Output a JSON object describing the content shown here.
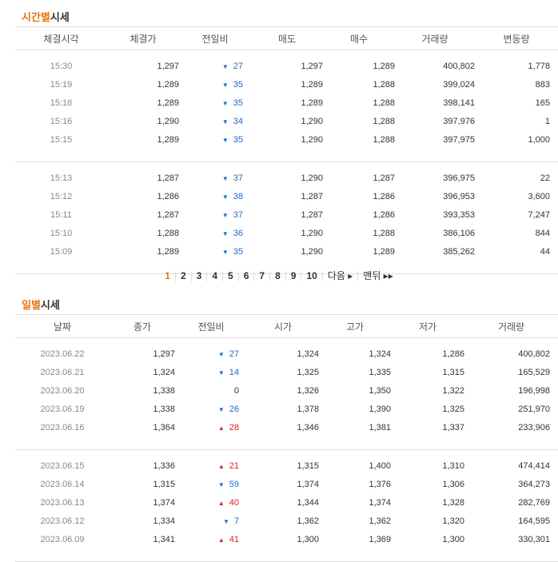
{
  "time_section": {
    "title_accent": "시간별",
    "title_rest": "시세",
    "headers": [
      "체결시각",
      "체결가",
      "전일비",
      "매도",
      "매수",
      "거래량",
      "변동량"
    ],
    "groups": [
      [
        {
          "time": "15:30",
          "price": "1,297",
          "dir": "down",
          "arrow": "▼",
          "change": "27",
          "ask": "1,297",
          "bid": "1,289",
          "volume": "400,802",
          "delta": "1,778"
        },
        {
          "time": "15:19",
          "price": "1,289",
          "dir": "down",
          "arrow": "▼",
          "change": "35",
          "ask": "1,289",
          "bid": "1,288",
          "volume": "399,024",
          "delta": "883"
        },
        {
          "time": "15:18",
          "price": "1,289",
          "dir": "down",
          "arrow": "▼",
          "change": "35",
          "ask": "1,289",
          "bid": "1,288",
          "volume": "398,141",
          "delta": "165"
        },
        {
          "time": "15:16",
          "price": "1,290",
          "dir": "down",
          "arrow": "▼",
          "change": "34",
          "ask": "1,290",
          "bid": "1,288",
          "volume": "397,976",
          "delta": "1"
        },
        {
          "time": "15:15",
          "price": "1,289",
          "dir": "down",
          "arrow": "▼",
          "change": "35",
          "ask": "1,290",
          "bid": "1,288",
          "volume": "397,975",
          "delta": "1,000"
        }
      ],
      [
        {
          "time": "15:13",
          "price": "1,287",
          "dir": "down",
          "arrow": "▼",
          "change": "37",
          "ask": "1,290",
          "bid": "1,287",
          "volume": "396,975",
          "delta": "22"
        },
        {
          "time": "15:12",
          "price": "1,286",
          "dir": "down",
          "arrow": "▼",
          "change": "38",
          "ask": "1,287",
          "bid": "1,286",
          "volume": "396,953",
          "delta": "3,600"
        },
        {
          "time": "15:11",
          "price": "1,287",
          "dir": "down",
          "arrow": "▼",
          "change": "37",
          "ask": "1,287",
          "bid": "1,286",
          "volume": "393,353",
          "delta": "7,247"
        },
        {
          "time": "15:10",
          "price": "1,288",
          "dir": "down",
          "arrow": "▼",
          "change": "36",
          "ask": "1,290",
          "bid": "1,288",
          "volume": "386,106",
          "delta": "844"
        },
        {
          "time": "15:09",
          "price": "1,289",
          "dir": "down",
          "arrow": "▼",
          "change": "35",
          "ask": "1,290",
          "bid": "1,289",
          "volume": "385,262",
          "delta": "44"
        }
      ]
    ]
  },
  "pager": {
    "pages": [
      "1",
      "2",
      "3",
      "4",
      "5",
      "6",
      "7",
      "8",
      "9",
      "10"
    ],
    "current": "1",
    "next": "다음 ▸",
    "last": "맨뒤 ▸▸"
  },
  "daily_section": {
    "title_accent": "일별",
    "title_rest": "시세",
    "headers": [
      "날짜",
      "종가",
      "전일비",
      "시가",
      "고가",
      "저가",
      "거래량"
    ],
    "groups": [
      [
        {
          "date": "2023.06.22",
          "close": "1,297",
          "dir": "down",
          "arrow": "▼",
          "change": "27",
          "open": "1,324",
          "high": "1,324",
          "low": "1,286",
          "volume": "400,802"
        },
        {
          "date": "2023.06.21",
          "close": "1,324",
          "dir": "down",
          "arrow": "▼",
          "change": "14",
          "open": "1,325",
          "high": "1,335",
          "low": "1,315",
          "volume": "165,529"
        },
        {
          "date": "2023.06.20",
          "close": "1,338",
          "dir": "same",
          "arrow": "",
          "change": "0",
          "open": "1,326",
          "high": "1,350",
          "low": "1,322",
          "volume": "196,998"
        },
        {
          "date": "2023.06.19",
          "close": "1,338",
          "dir": "down",
          "arrow": "▼",
          "change": "26",
          "open": "1,378",
          "high": "1,390",
          "low": "1,325",
          "volume": "251,970"
        },
        {
          "date": "2023.06.16",
          "close": "1,364",
          "dir": "up",
          "arrow": "▲",
          "change": "28",
          "open": "1,346",
          "high": "1,381",
          "low": "1,337",
          "volume": "233,906"
        }
      ],
      [
        {
          "date": "2023.06.15",
          "close": "1,336",
          "dir": "up",
          "arrow": "▲",
          "change": "21",
          "open": "1,315",
          "high": "1,400",
          "low": "1,310",
          "volume": "474,414"
        },
        {
          "date": "2023.06.14",
          "close": "1,315",
          "dir": "down",
          "arrow": "▼",
          "change": "59",
          "open": "1,374",
          "high": "1,376",
          "low": "1,306",
          "volume": "364,273"
        },
        {
          "date": "2023.06.13",
          "close": "1,374",
          "dir": "up",
          "arrow": "▲",
          "change": "40",
          "open": "1,344",
          "high": "1,374",
          "low": "1,328",
          "volume": "282,769"
        },
        {
          "date": "2023.06.12",
          "close": "1,334",
          "dir": "down",
          "arrow": "▼",
          "change": "7",
          "open": "1,362",
          "high": "1,362",
          "low": "1,320",
          "volume": "164,595"
        },
        {
          "date": "2023.06.09",
          "close": "1,341",
          "dir": "up",
          "arrow": "▲",
          "change": "41",
          "open": "1,300",
          "high": "1,369",
          "low": "1,300",
          "volume": "330,301"
        }
      ]
    ]
  }
}
